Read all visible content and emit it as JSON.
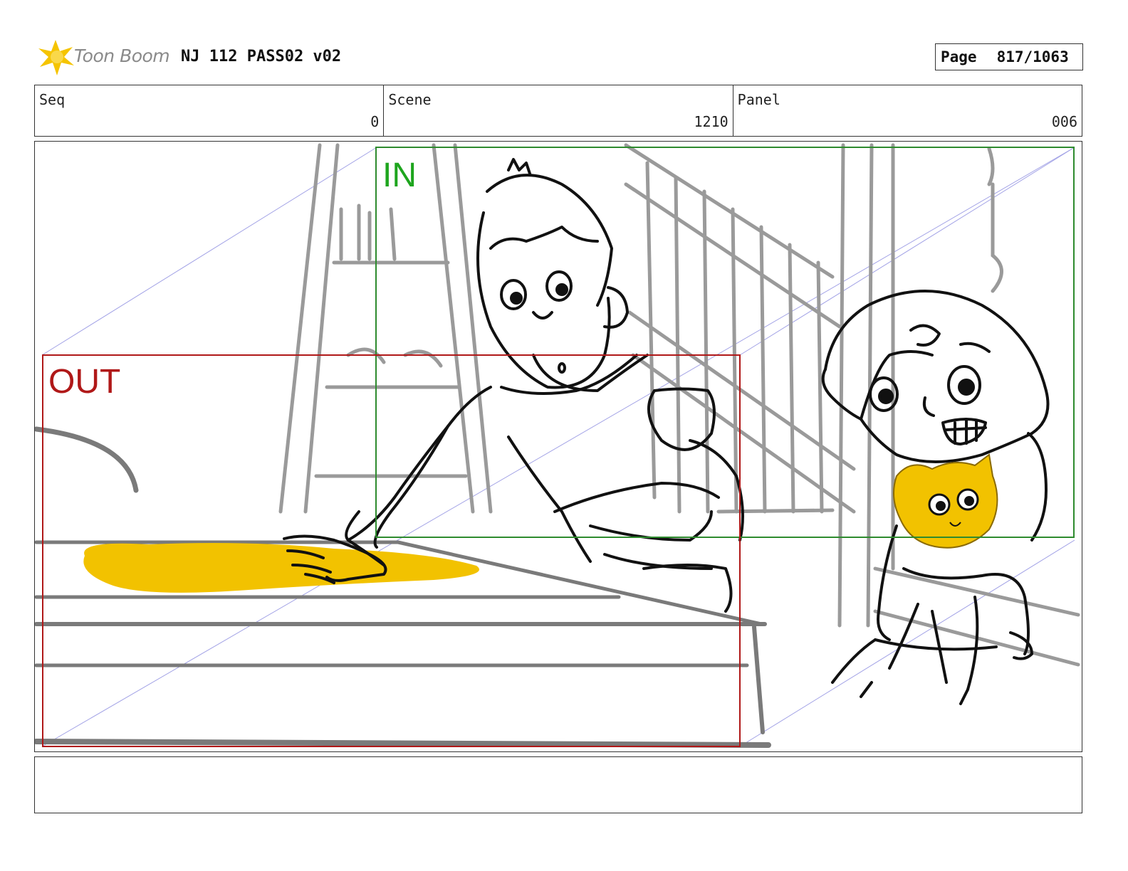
{
  "header": {
    "logo_text": "Toon Boom",
    "title": "NJ 112 PASS02 v02",
    "page_label": "Page",
    "page_number": "817/1063"
  },
  "info": {
    "seq_label": "Seq",
    "seq_value": "0",
    "scene_label": "Scene",
    "scene_value": "1210",
    "panel_label": "Panel",
    "panel_value": "006"
  },
  "panel": {
    "in_label": "IN",
    "out_label": "OUT",
    "colors": {
      "in_frame": "#2e8b2e",
      "out_frame": "#b01818",
      "spill": "#f2c200",
      "guide": "#8c8ce0"
    }
  },
  "notes": {
    "text": ""
  }
}
